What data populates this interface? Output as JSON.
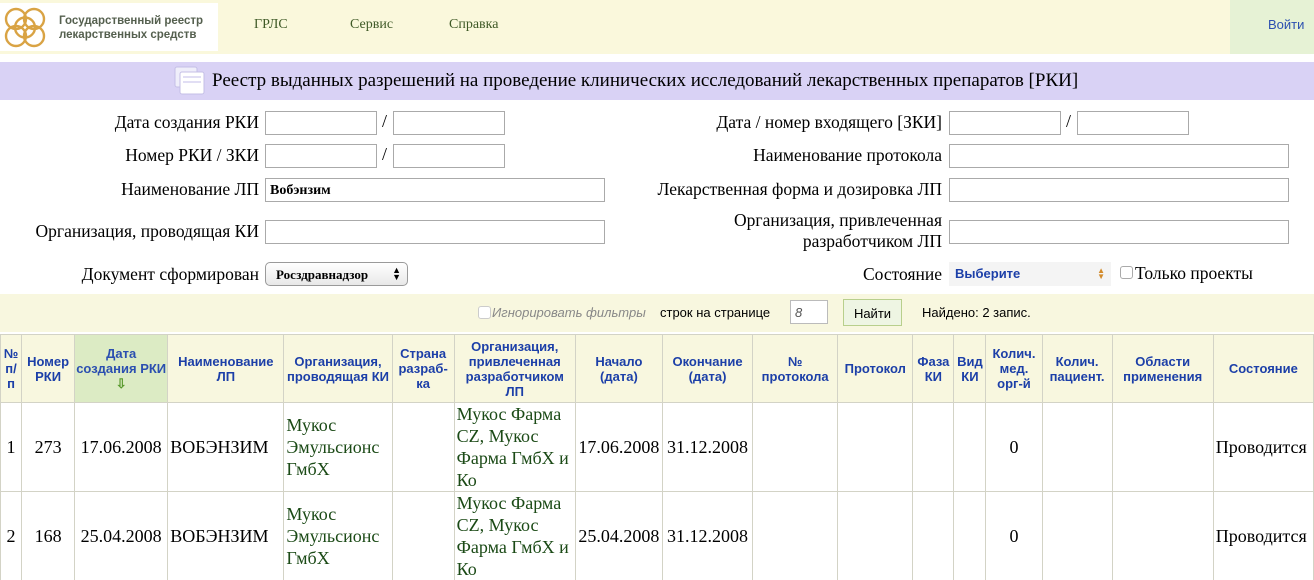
{
  "header": {
    "logo_line1": "Государственный реестр",
    "logo_line2": "лекарственных средств",
    "nav": [
      "ГРЛС",
      "Сервис",
      "Справка"
    ],
    "login": "Войти"
  },
  "title": "Реестр выданных разрешений на проведение клинических исследований лекарственных препаратов [РКИ]",
  "form": {
    "created_date_label": "Дата создания РКИ",
    "rki_number_label": "Номер РКИ / ЗКИ",
    "drug_name_label": "Наименование ЛП",
    "drug_name_value": "Вобэнзим",
    "org_label": "Организация, проводящая КИ",
    "doc_label": "Документ сформирован",
    "doc_value": "Росздравнадзор",
    "incoming_label": "Дата / номер входящего [ЗКИ]",
    "protocol_label": "Наименование протокола",
    "dosage_label": "Лекарственная форма и дозировка ЛП",
    "dev_org_label_1": "Организация, привлеченная",
    "dev_org_label_2": "разработчиком ЛП",
    "status_label": "Состояние",
    "status_value": "Выберите",
    "only_projects": "Только проекты",
    "slash": "/"
  },
  "filter": {
    "ignore_filters": "Игнорировать фильтры",
    "rows_per_page_label": "строк на странице",
    "rows_per_page_value": "8",
    "find_button": "Найти",
    "found": "Найдено: 2 запис."
  },
  "table": {
    "headers": [
      "№ п/п",
      "Номер РКИ",
      "Дата создания РКИ",
      "Наименование ЛП",
      "Организация, проводящая КИ",
      "Страна разраб-ка",
      "Организация, привлеченная разработчиком ЛП",
      "Начало (дата)",
      "Окончание (дата)",
      "№ протокола",
      "Протокол",
      "Фаза КИ",
      "Вид КИ",
      "Колич. мед. орг-й",
      "Колич. пациент.",
      "Области применения",
      "Состояние"
    ],
    "sort_arrow": "⇩",
    "rows": [
      {
        "n": "1",
        "number": "273",
        "created": "17.06.2008",
        "name": "ВОБЭНЗИМ",
        "org": "Мукос Эмульсионс ГмбХ",
        "country": "",
        "dev_org": "Мукос Фарма CZ, Мукос Фарма ГмбХ и Ко",
        "start": "17.06.2008",
        "end": "31.12.2008",
        "protocol_no": "",
        "protocol": "",
        "phase": "",
        "kind": "",
        "med_orgs": "0",
        "patients": "",
        "areas": "",
        "status": "Проводится"
      },
      {
        "n": "2",
        "number": "168",
        "created": "25.04.2008",
        "name": "ВОБЭНЗИМ",
        "org": "Мукос Эмульсионс ГмбХ",
        "country": "",
        "dev_org": "Мукос Фарма CZ, Мукос Фарма ГмбХ и Ко",
        "start": "25.04.2008",
        "end": "31.12.2008",
        "protocol_no": "",
        "protocol": "",
        "phase": "",
        "kind": "",
        "med_orgs": "0",
        "patients": "",
        "areas": "",
        "status": "Проводится"
      }
    ]
  }
}
